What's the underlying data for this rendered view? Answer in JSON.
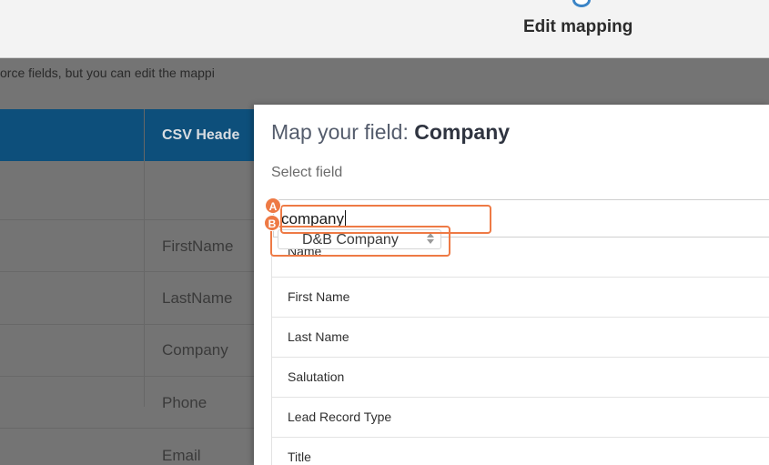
{
  "wizard": {
    "step_label": "Edit mapping"
  },
  "background": {
    "intro_text": "orce fields, but you can edit the mappi",
    "column_header": "CSV Heade",
    "rows": [
      "FirstName",
      "LastName",
      "Company",
      "Phone",
      "Email"
    ]
  },
  "modal": {
    "title_prefix": "Map your field: ",
    "title_field": "Company",
    "select_label": "Select field",
    "search_value": "company",
    "dnb_option": "D&B Company",
    "options": [
      "Name",
      "First Name",
      "Last Name",
      "Salutation",
      "Lead Record Type",
      "Title"
    ]
  },
  "annotations": {
    "a": "A",
    "b": "B"
  },
  "colors": {
    "accent": "#ee7a45",
    "header_blue": "#0d4f7b",
    "overlay": "#747474"
  }
}
